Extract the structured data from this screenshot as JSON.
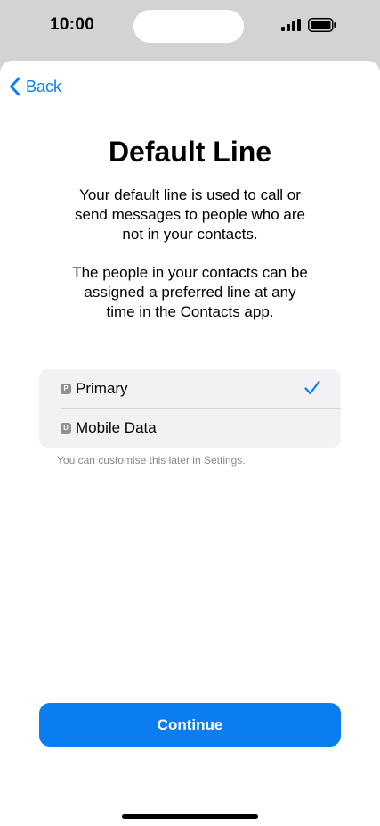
{
  "status_bar": {
    "time": "10:00"
  },
  "nav": {
    "back_label": "Back"
  },
  "header": {
    "title": "Default Line"
  },
  "body": {
    "paragraph_1": "Your default line is used to call or send messages to people who are not in your contacts.",
    "paragraph_2": "The people in your contacts can be assigned a preferred line at any time in the Contacts app."
  },
  "options": [
    {
      "badge": "P",
      "label": "Primary",
      "selected": true
    },
    {
      "badge": "D",
      "label": "Mobile Data",
      "selected": false
    }
  ],
  "hint": "You can customise this later in Settings.",
  "footer": {
    "continue_label": "Continue"
  },
  "colors": {
    "accent": "#0a7ef0",
    "badge": "#8e8e93",
    "group_background": "#f2f2f4"
  }
}
